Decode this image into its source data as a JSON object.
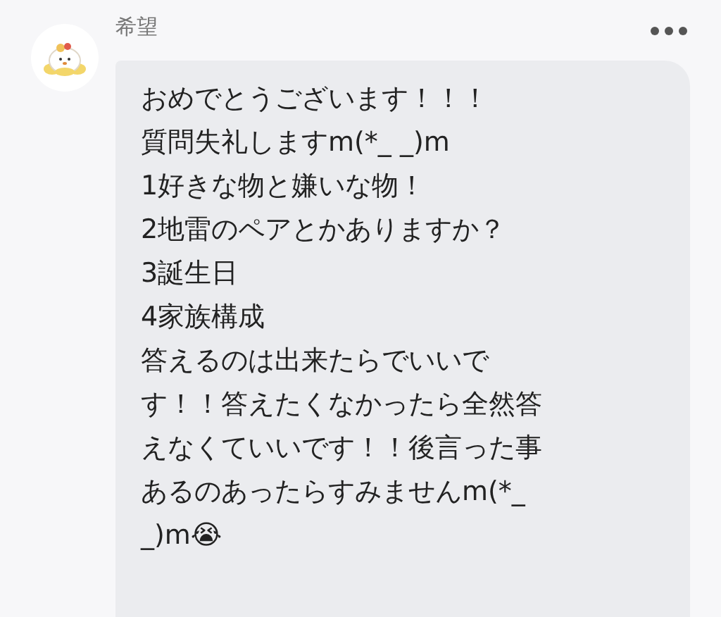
{
  "author": {
    "name": "希望"
  },
  "message": {
    "lines": [
      "おめでとうございます！！！",
      "質問失礼しますm(*_ _)m",
      "1好きな物と嫌いな物！",
      "2地雷のペアとかありますか？",
      "3誕生日",
      "4家族構成",
      "答えるのは出来たらでいいで",
      "す！！答えたくなかったら全然答",
      "えなくていいです！！後言った事",
      "あるのあったらすみませんm(*_",
      "_)m😭"
    ]
  }
}
